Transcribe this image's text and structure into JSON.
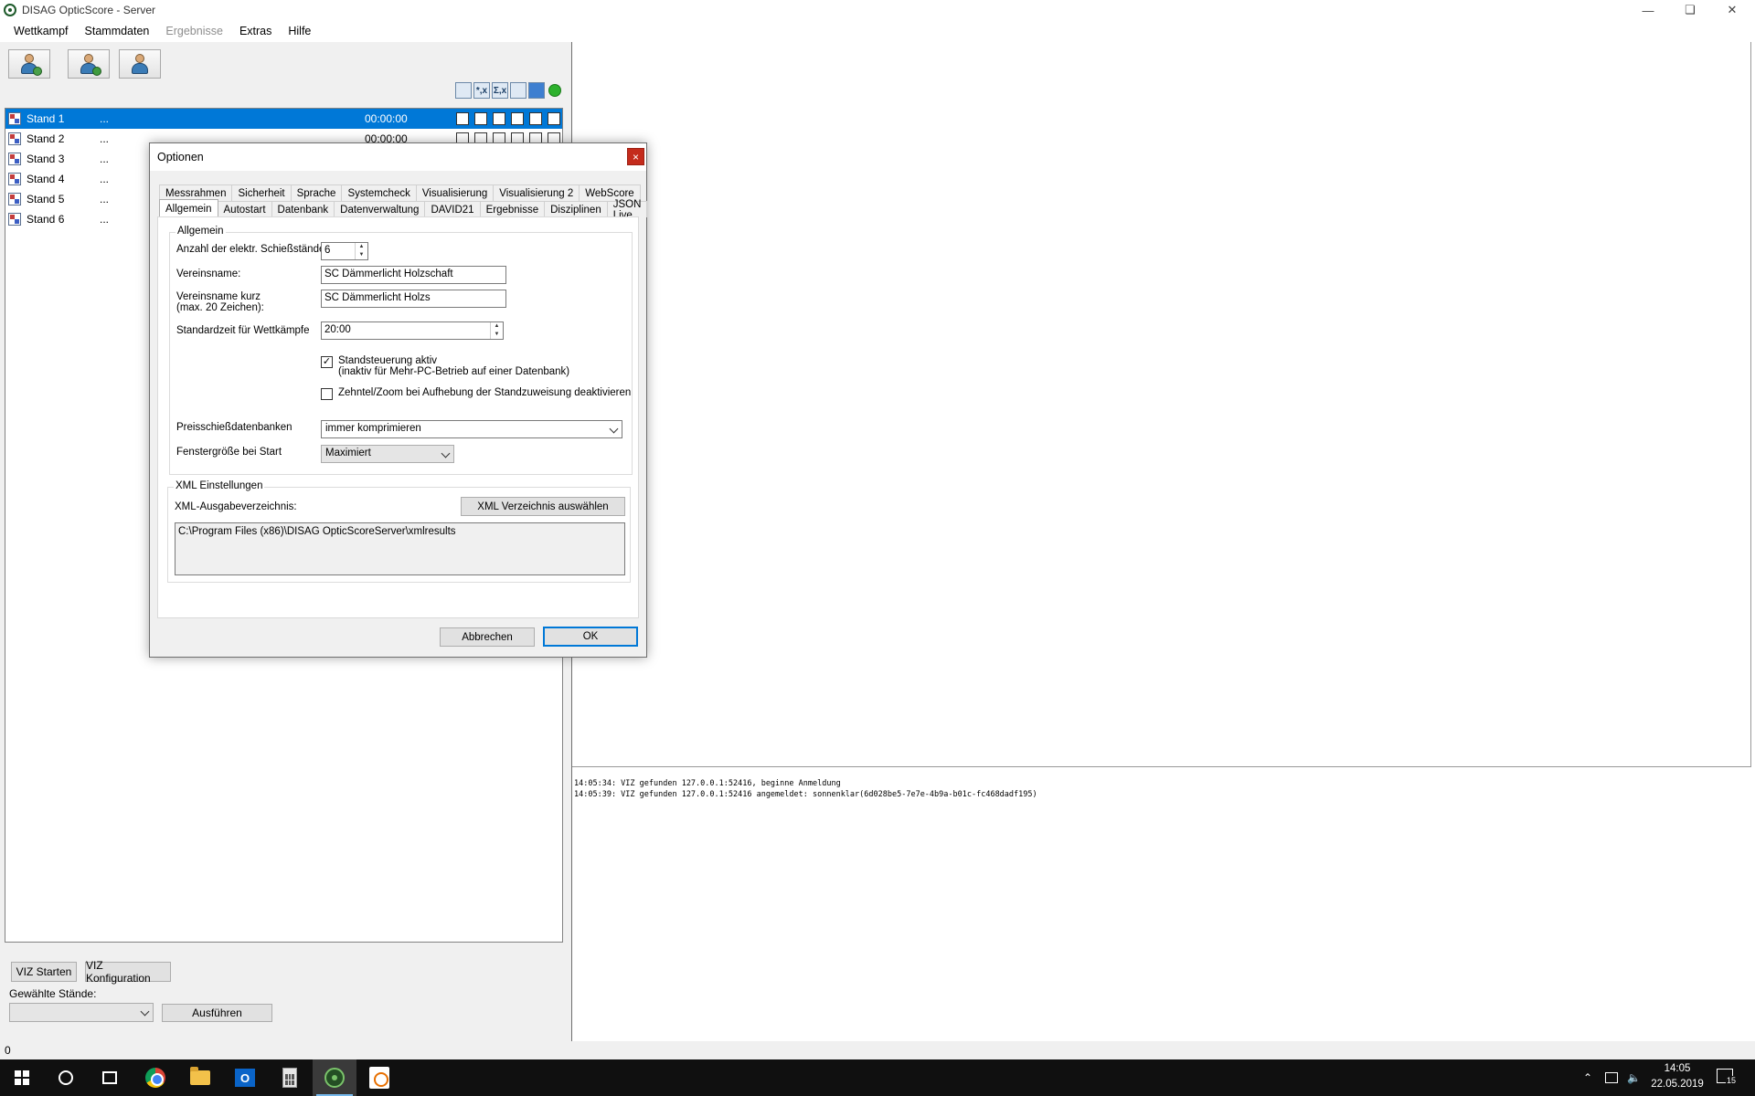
{
  "window": {
    "title": "DISAG OpticScore - Server"
  },
  "menu": [
    "Wettkampf",
    "Stammdaten",
    "Ergebnisse",
    "Extras",
    "Hilfe"
  ],
  "stands": [
    {
      "name": "Stand 1",
      "dots": "...",
      "time": "00:00:00",
      "selected": true
    },
    {
      "name": "Stand 2",
      "dots": "...",
      "time": "00:00:00"
    },
    {
      "name": "Stand 3",
      "dots": "..."
    },
    {
      "name": "Stand 4",
      "dots": "..."
    },
    {
      "name": "Stand 5",
      "dots": "..."
    },
    {
      "name": "Stand 6",
      "dots": "..."
    }
  ],
  "toolbar_mini": {
    "icon1": "",
    "icon2": "*,x",
    "icon3": "Σ,x",
    "icon4": ""
  },
  "bottom": {
    "viz_start": "VIZ Starten",
    "viz_config": "VIZ Konfiguration",
    "selected_label": "Gewählte Stände:",
    "selected_value": "",
    "run": "Ausführen"
  },
  "log": [
    "14:05:34: VIZ gefunden 127.0.0.1:52416, beginne Anmeldung",
    "14:05:39: VIZ gefunden 127.0.0.1:52416 angemeldet: sonnenklar(6d028be5-7e7e-4b9a-b01c-fc468dadf195)"
  ],
  "status": "0",
  "taskbar": {
    "time": "14:05",
    "date": "22.05.2019",
    "notifications": "15"
  },
  "dialog": {
    "title": "Optionen",
    "close": "×",
    "tabs_row1": [
      "Messrahmen",
      "Sicherheit",
      "Sprache",
      "Systemcheck",
      "Visualisierung",
      "Visualisierung 2",
      "WebScore"
    ],
    "tabs_row2": [
      "Allgemein",
      "Autostart",
      "Datenbank",
      "Datenverwaltung",
      "DAVID21",
      "Ergebnisse",
      "Disziplinen",
      "JSON Live"
    ],
    "general": {
      "legend": "Allgemein",
      "stands_label": "Anzahl der elektr. Schießstände:",
      "stands_value": "6",
      "club_label": "Vereinsname:",
      "club_value": "SC Dämmerlicht Holzschaft",
      "club_short_label": "Vereinsname kurz",
      "club_short_hint": "(max. 20 Zeichen):",
      "club_short_value": "SC Dämmerlicht Holzs",
      "std_time_label": "Standardzeit für Wettkämpfe",
      "std_time_value": "20:00",
      "check1_label": "Standsteuerung aktiv",
      "check1_hint": "(inaktiv für Mehr-PC-Betrieb auf einer Datenbank)",
      "check1_checked": true,
      "check2_label": "Zehntel/Zoom bei Aufhebung der Standzuweisung deaktivieren",
      "check2_checked": false,
      "prize_label": "Preisschießdatenbanken",
      "prize_value": "immer komprimieren",
      "window_label": "Fenstergröße bei Start",
      "window_value": "Maximiert"
    },
    "xml": {
      "legend": "XML Einstellungen",
      "dir_label": "XML-Ausgabeverzeichnis:",
      "choose_button": "XML Verzeichnis auswählen",
      "path": "C:\\Program Files (x86)\\DISAG OpticScoreServer\\xmlresults"
    },
    "cancel": "Abbrechen",
    "ok": "OK"
  }
}
